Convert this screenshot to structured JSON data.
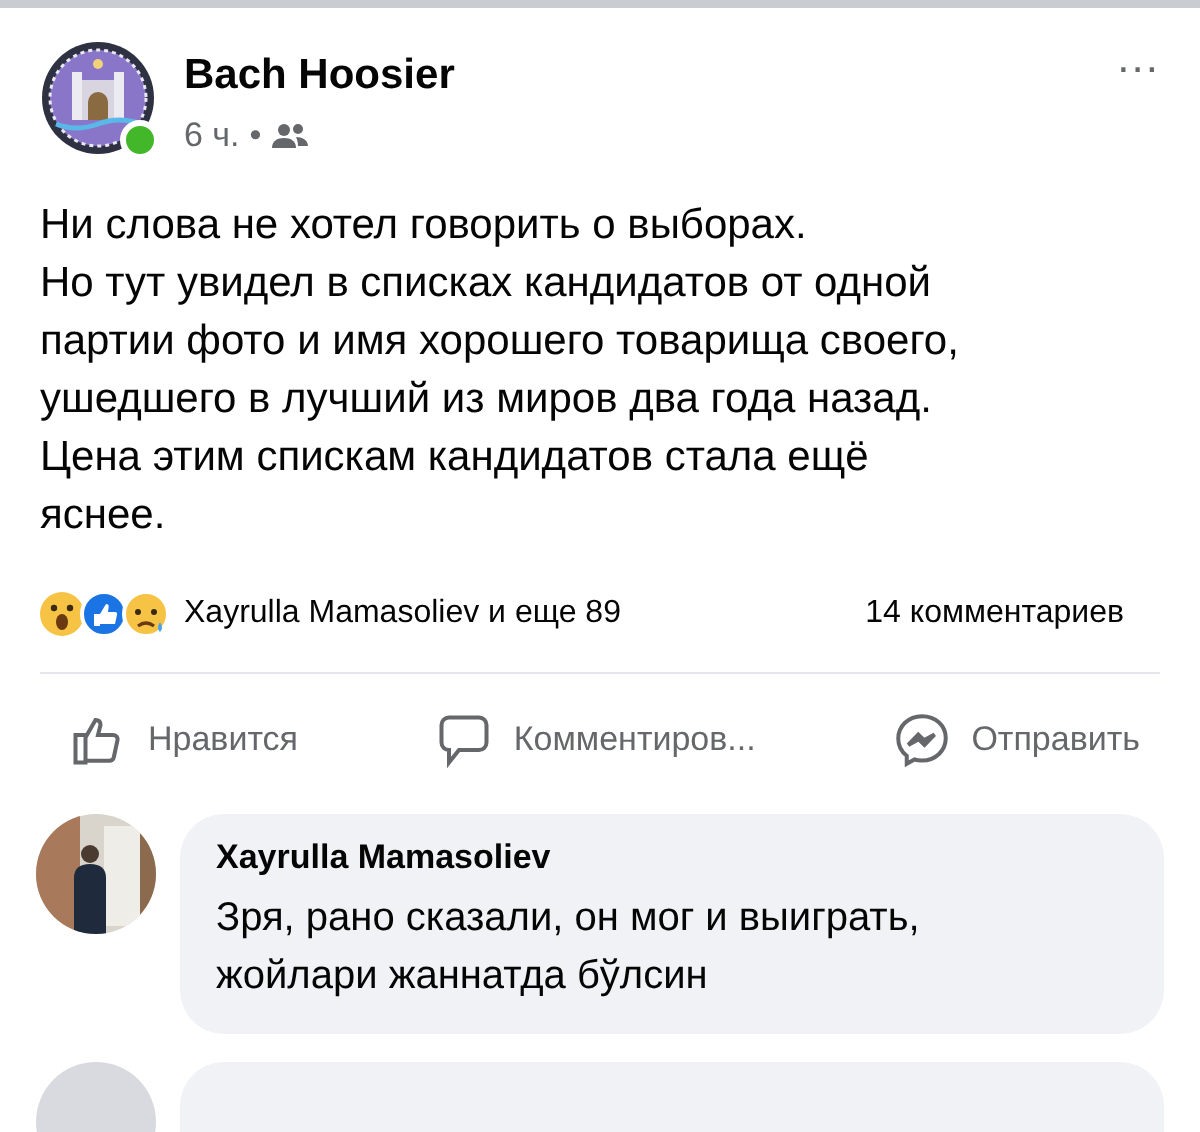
{
  "post": {
    "author": "Bach Hoosier",
    "time": "6 ч.",
    "separator": "•",
    "online": true,
    "more": "...",
    "text": "Ни слова не хотел говорить о выборах.\nНо тут увидел в списках кандидатов от одной\nпартии фото и имя хорошего товарища своего,\nушедшего в лучший из миров два года назад.\nЦена этим спискам кандидатов стала ещё\nяснее."
  },
  "reactions": {
    "summary": "Xayrulla Mamasoliev и еще 89",
    "comments_count": "14 комментариев"
  },
  "actions": [
    {
      "kind": "like",
      "label": "Нравится"
    },
    {
      "kind": "comment",
      "label": "Комментиров..."
    },
    {
      "kind": "share",
      "label": "Отправить"
    }
  ],
  "comments": [
    {
      "author": "Xayrulla Mamasoliev",
      "text": "Зря, рано сказали, он мог и выиграть,\nжойлари жаннатда бўлсин"
    }
  ]
}
